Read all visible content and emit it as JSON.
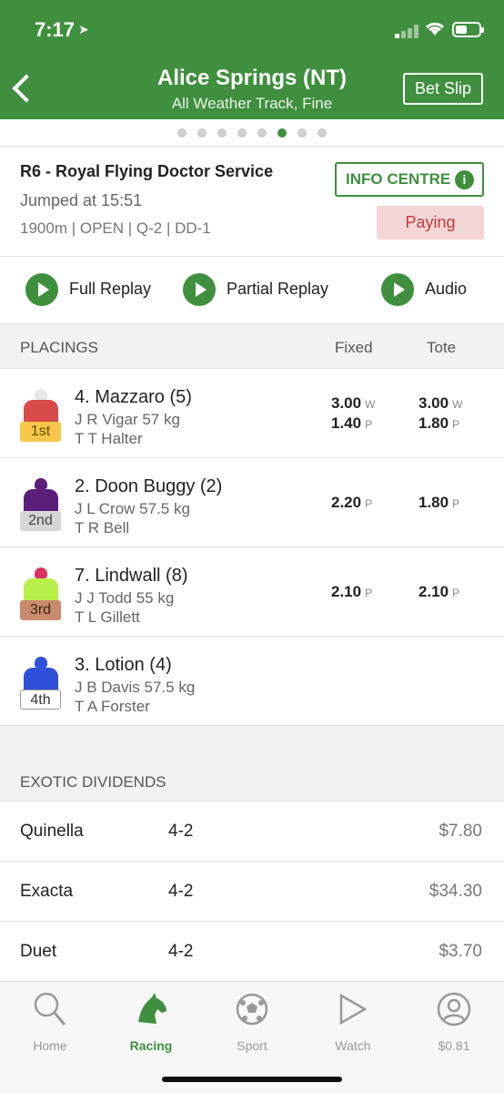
{
  "status": {
    "time": "7:17"
  },
  "header": {
    "title": "Alice Springs (NT)",
    "subtitle": "All Weather Track, Fine",
    "bet_slip_label": "Bet Slip"
  },
  "pager": {
    "count": 8,
    "active_index": 5
  },
  "race": {
    "name": "R6 - Royal Flying Doctor Service",
    "jumped": "Jumped at 15:51",
    "info": "1900m | OPEN | Q-2 | DD-1",
    "info_centre_label": "INFO CENTRE",
    "status_label": "Paying"
  },
  "replays": {
    "full": "Full Replay",
    "partial": "Partial Replay",
    "audio": "Audio"
  },
  "placings": {
    "header": "PLACINGS",
    "fixed_label": "Fixed",
    "tote_label": "Tote",
    "runners": [
      {
        "place": "1st",
        "name": "4. Mazzaro (5)",
        "jockey": "J R Vigar 57 kg",
        "trainer": "T T Halter",
        "silk_cap": "#e8e8e8",
        "silk_body": "#d94a4a",
        "badge_bg": "#f6c64a",
        "badge_fg": "#6b4b00",
        "fixed_win": "3.00",
        "fixed_place": "1.40",
        "tote_win": "3.00",
        "tote_place": "1.80"
      },
      {
        "place": "2nd",
        "name": "2. Doon Buggy (2)",
        "jockey": "J L Crow 57.5 kg",
        "trainer": "T R Bell",
        "silk_cap": "#5b1f7a",
        "silk_body": "#5b1f7a",
        "badge_bg": "#d6d6d6",
        "badge_fg": "#444",
        "fixed_win": "",
        "fixed_place": "2.20",
        "tote_win": "",
        "tote_place": "1.80"
      },
      {
        "place": "3rd",
        "name": "7. Lindwall (8)",
        "jockey": "J J Todd 55 kg",
        "trainer": "T L Gillett",
        "silk_cap": "#d8345f",
        "silk_body": "#b8f04a",
        "badge_bg": "#c98a6d",
        "badge_fg": "#3b2315",
        "fixed_win": "",
        "fixed_place": "2.10",
        "tote_win": "",
        "tote_place": "2.10"
      },
      {
        "place": "4th",
        "name": "3. Lotion (4)",
        "jockey": "J B Davis 57.5 kg",
        "trainer": "T A Forster",
        "silk_cap": "#2e4fd8",
        "silk_body": "#2e4fd8",
        "badge_bg": "#ffffff",
        "badge_fg": "#333",
        "fixed_win": "",
        "fixed_place": "",
        "tote_win": "",
        "tote_place": ""
      }
    ],
    "win_marker": "W",
    "place_marker": "P"
  },
  "exotics": {
    "header": "EXOTIC DIVIDENDS",
    "rows": [
      {
        "name": "Quinella",
        "combo": "4-2",
        "amount": "$7.80"
      },
      {
        "name": "Exacta",
        "combo": "4-2",
        "amount": "$34.30"
      },
      {
        "name": "Duet",
        "combo": "4-2",
        "amount": "$3.70"
      }
    ]
  },
  "tabs": [
    {
      "label": "Home",
      "icon": "magnifier-icon"
    },
    {
      "label": "Racing",
      "icon": "horse-head-icon",
      "active": true
    },
    {
      "label": "Sport",
      "icon": "soccer-ball-icon"
    },
    {
      "label": "Watch",
      "icon": "play-icon"
    },
    {
      "label": "$0.81",
      "icon": "account-icon"
    }
  ],
  "colors": {
    "brand": "#3f8f3f",
    "paying_bg": "#f4d6d6",
    "paying_fg": "#c23b3b"
  }
}
